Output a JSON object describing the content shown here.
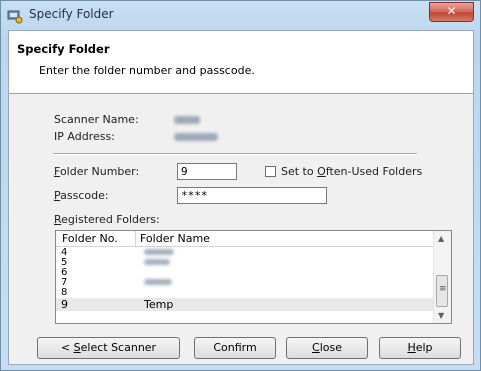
{
  "window": {
    "title": "Specify Folder",
    "close_glyph": "✕"
  },
  "header": {
    "title": "Specify Folder",
    "subtitle": "Enter the folder number and passcode."
  },
  "info": {
    "scanner_name_label": "Scanner Name:",
    "ip_address_label": "IP Address:"
  },
  "form": {
    "folder_number_label": "Folder Number:",
    "folder_number_value": "9",
    "often_used_label": "Set to Often-Used Folders",
    "often_used_checked": false,
    "passcode_label": "Passcode:",
    "passcode_value": "****",
    "registered_label": "Registered Folders:"
  },
  "table": {
    "columns": [
      "Folder No.",
      "Folder Name"
    ],
    "rows": [
      {
        "no": "4",
        "name": ""
      },
      {
        "no": "5",
        "name": ""
      },
      {
        "no": "6",
        "name": ""
      },
      {
        "no": "7",
        "name": ""
      },
      {
        "no": "8",
        "name": ""
      },
      {
        "no": "9",
        "name": "Temp"
      }
    ],
    "selected_row": 5
  },
  "icons": {
    "scroll_up": "▲",
    "scroll_down": "▼",
    "thumb_grip": "≡",
    "app": "scanner-icon"
  },
  "buttons": {
    "select_scanner": "< Select Scanner",
    "confirm": "Confirm",
    "close": "Close",
    "help": "Help"
  }
}
